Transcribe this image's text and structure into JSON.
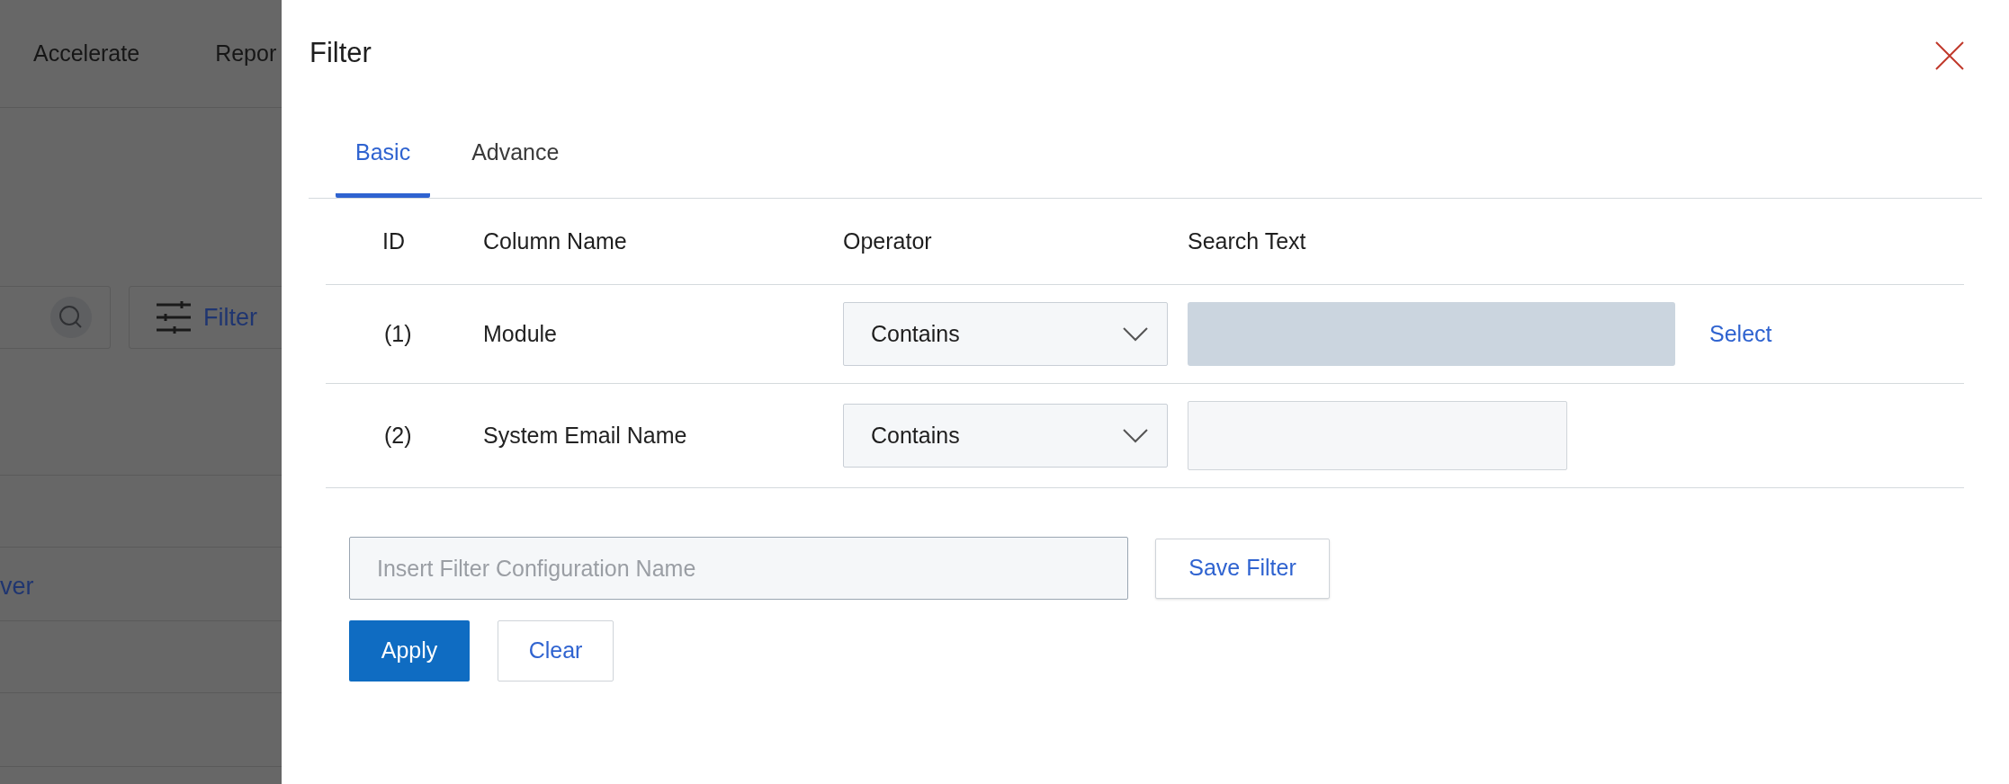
{
  "background": {
    "nav_items": [
      "Accelerate",
      "Repor"
    ],
    "filter_button": "Filter",
    "link_text": "ver"
  },
  "filter_panel": {
    "title": "Filter",
    "tabs": [
      {
        "label": "Basic",
        "selected": true
      },
      {
        "label": "Advance",
        "selected": false
      }
    ],
    "table": {
      "columns": [
        "ID",
        "Column Name",
        "Operator",
        "Search Text"
      ],
      "rows": [
        {
          "id": "(1)",
          "column_name": "Module",
          "operator": "Contains",
          "search_disabled": true,
          "action": "Select"
        },
        {
          "id": "(2)",
          "column_name": "System Email Name",
          "operator": "Contains",
          "search_disabled": false
        }
      ]
    },
    "config_name": {
      "placeholder": "Insert Filter Configuration Name"
    },
    "save_button": "Save Filter",
    "buttons": [
      {
        "label": "Apply",
        "kind": "primary"
      },
      {
        "label": "Clear",
        "kind": "secondary"
      }
    ]
  }
}
